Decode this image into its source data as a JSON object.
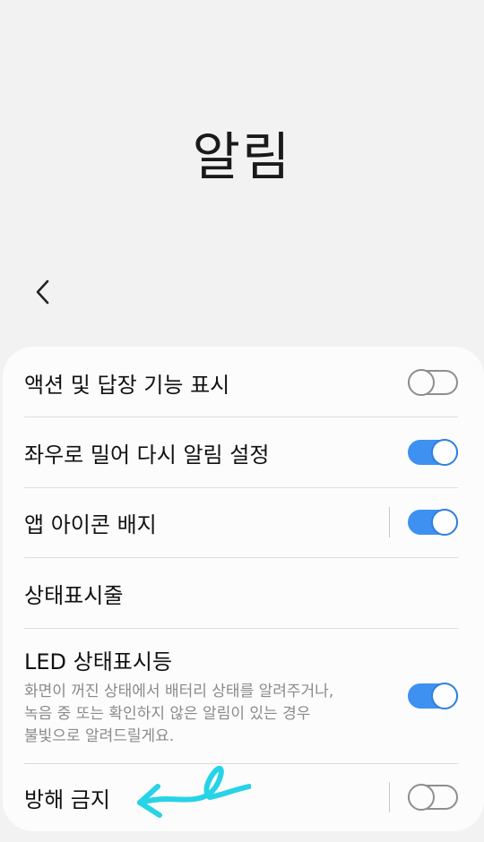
{
  "header": {
    "title": "알림"
  },
  "settings": {
    "items": [
      {
        "label": "액션 및 답장 기능 표시",
        "toggle": "off"
      },
      {
        "label": "좌우로 밀어 다시 알림 설정",
        "toggle": "on"
      },
      {
        "label": "앱 아이콘 배지",
        "toggle": "on"
      },
      {
        "label": "상태표시줄"
      },
      {
        "label": "LED 상태표시등",
        "description_lines": [
          "화면이 꺼진 상태에서 배터리 상태를 알려주거나,",
          "녹음 중 또는 확인하지 않은 알림이 있는 경우",
          "불빛으로 알려드릴게요."
        ],
        "toggle": "on"
      },
      {
        "label": "방해 금지",
        "toggle": "off"
      }
    ]
  },
  "colors": {
    "accent": "#3e91f1",
    "annotation": "#27d3e6",
    "background": "#f2f2f2",
    "card": "#fcfcfc"
  },
  "icons": {
    "back": "chevron-left-icon",
    "annotation": "hand-drawn-arrow"
  }
}
